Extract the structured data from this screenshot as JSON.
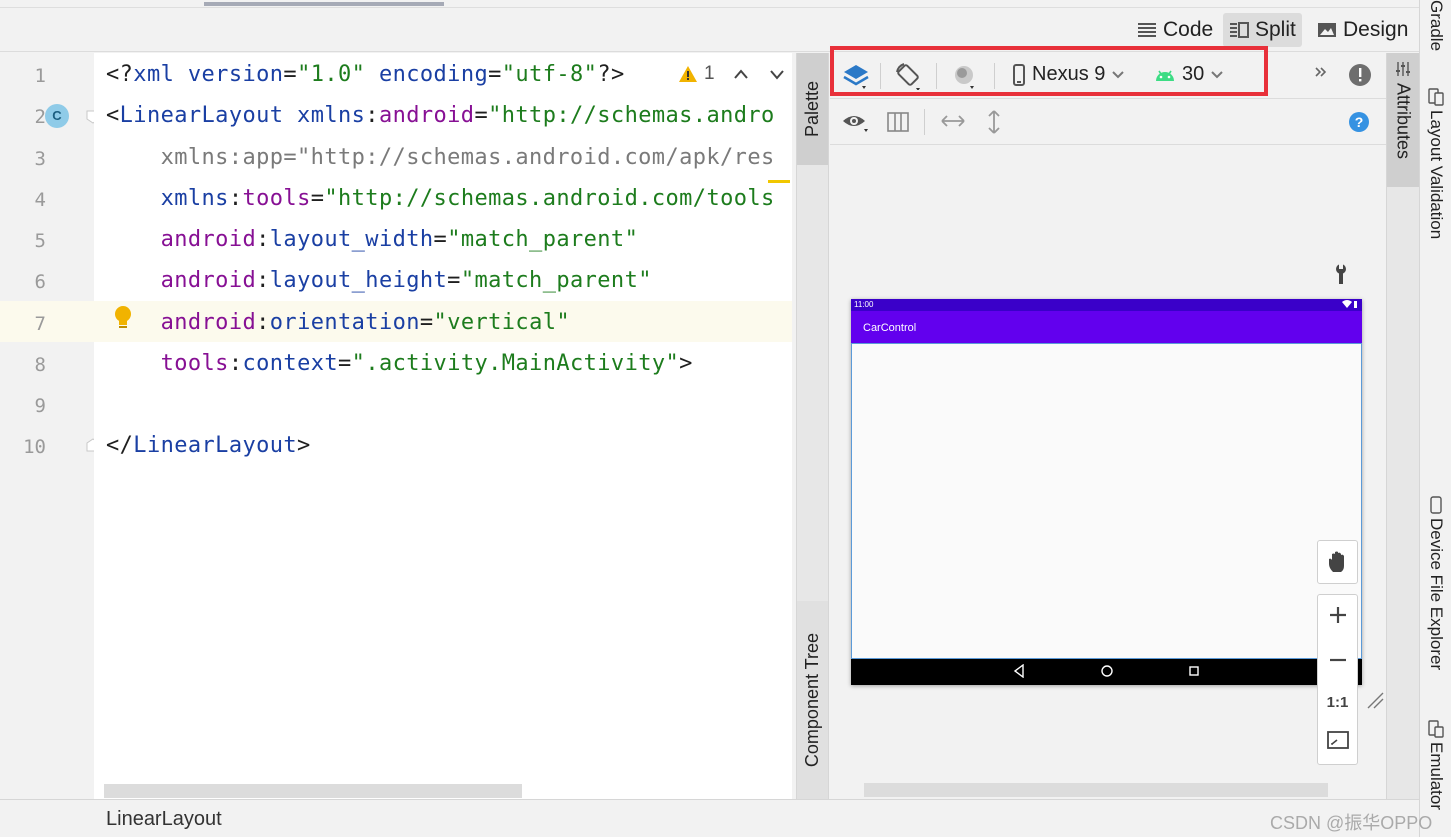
{
  "view_modes": [
    {
      "id": "code",
      "label": "Code",
      "icon": "lines-icon",
      "selected": false
    },
    {
      "id": "split",
      "label": "Split",
      "icon": "split-icon",
      "selected": true
    },
    {
      "id": "design",
      "label": "Design",
      "icon": "image-icon",
      "selected": false
    }
  ],
  "editor": {
    "line_numbers": [
      "1",
      "2",
      "3",
      "4",
      "5",
      "6",
      "7",
      "8",
      "9",
      "10"
    ],
    "warning_count": "1",
    "lines": [
      [
        [
          "t-punc",
          "<?"
        ],
        [
          "t-tag",
          "xml "
        ],
        [
          "t-attr",
          "version"
        ],
        [
          "t-punc",
          "="
        ],
        [
          "t-str",
          "\"1.0\" "
        ],
        [
          "t-attr",
          "encoding"
        ],
        [
          "t-punc",
          "="
        ],
        [
          "t-str",
          "\"utf-8\""
        ],
        [
          "t-punc",
          "?>"
        ]
      ],
      [
        [
          "t-punc",
          "<"
        ],
        [
          "t-tag",
          "LinearLayout "
        ],
        [
          "t-attr",
          "xmlns"
        ],
        [
          "t-punc",
          ":"
        ],
        [
          "t-ns",
          "android"
        ],
        [
          "t-punc",
          "="
        ],
        [
          "t-str",
          "\"http://schemas.andro"
        ]
      ],
      [
        [
          "t-gray",
          "    xmlns:app=\"http://schemas.android.com/apk/res"
        ]
      ],
      [
        [
          "t-punc",
          "    "
        ],
        [
          "t-attr",
          "xmlns"
        ],
        [
          "t-punc",
          ":"
        ],
        [
          "t-ns",
          "tools"
        ],
        [
          "t-punc",
          "="
        ],
        [
          "t-str",
          "\"http://schemas.android.com/tools"
        ]
      ],
      [
        [
          "t-punc",
          "    "
        ],
        [
          "t-ns",
          "android"
        ],
        [
          "t-punc",
          ":"
        ],
        [
          "t-attr",
          "layout_width"
        ],
        [
          "t-punc",
          "="
        ],
        [
          "t-str",
          "\"match_parent\""
        ]
      ],
      [
        [
          "t-punc",
          "    "
        ],
        [
          "t-ns",
          "android"
        ],
        [
          "t-punc",
          ":"
        ],
        [
          "t-attr",
          "layout_height"
        ],
        [
          "t-punc",
          "="
        ],
        [
          "t-str",
          "\"match_parent\""
        ]
      ],
      [
        [
          "t-punc",
          "    "
        ],
        [
          "t-ns",
          "android"
        ],
        [
          "t-punc",
          ":"
        ],
        [
          "t-attr",
          "orientation"
        ],
        [
          "t-punc",
          "="
        ],
        [
          "t-str",
          "\"vertical\""
        ]
      ],
      [
        [
          "t-punc",
          "    "
        ],
        [
          "t-ns",
          "tools"
        ],
        [
          "t-punc",
          ":"
        ],
        [
          "t-attr",
          "context"
        ],
        [
          "t-punc",
          "="
        ],
        [
          "t-str",
          "\".activity.MainActivity\""
        ],
        [
          "t-punc",
          ">"
        ]
      ],
      [],
      [
        [
          "t-punc",
          "</"
        ],
        [
          "t-tag",
          "LinearLayout"
        ],
        [
          "t-punc",
          ">"
        ]
      ]
    ]
  },
  "side_tabs": {
    "palette": "Palette",
    "component_tree": "Component Tree",
    "attributes": "Attributes"
  },
  "design_toolbar": {
    "device": "Nexus 9",
    "api_level": "30"
  },
  "preview": {
    "status_time": "11:00",
    "app_title": "CarControl",
    "zoom_actual": "1:1"
  },
  "right_tool_windows": [
    "Gradle",
    "Layout Validation",
    "Device File Explorer",
    "Emulator"
  ],
  "status": {
    "breadcrumb": "LinearLayout"
  },
  "watermark": "CSDN @振华OPPO",
  "colors": {
    "accent": "#6200ee",
    "status_bar": "#3a00c9",
    "highlight_box": "#e8303a"
  }
}
